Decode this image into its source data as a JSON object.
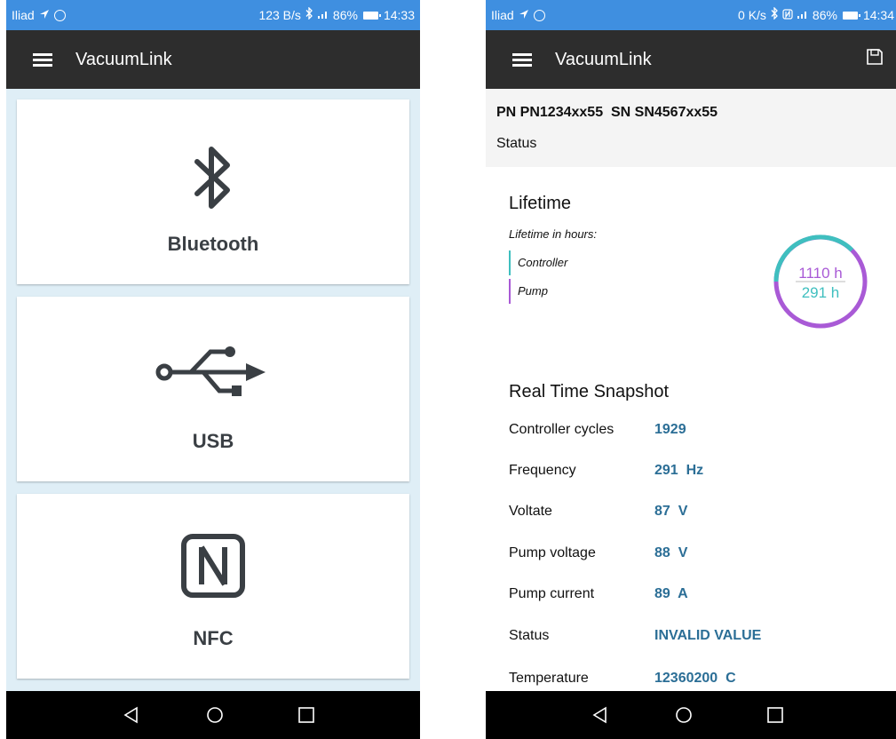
{
  "left": {
    "status_bar": {
      "carrier": "Iliad",
      "speed": "123 B/s",
      "battery": "86%",
      "time": "14:33"
    },
    "app_title": "VacuumLink",
    "connections": [
      {
        "label": "Bluetooth",
        "icon": "bluetooth-icon"
      },
      {
        "label": "USB",
        "icon": "usb-icon"
      },
      {
        "label": "NFC",
        "icon": "nfc-icon"
      }
    ]
  },
  "right": {
    "status_bar": {
      "carrier": "Iliad",
      "speed": "0 K/s",
      "battery": "86%",
      "time": "14:34"
    },
    "app_title": "VacuumLink",
    "pn_sn": "PN PN1234xx55  SN SN4567xx55",
    "status_link": "Status",
    "lifetime": {
      "title": "Lifetime",
      "subtitle": "Lifetime in hours:",
      "legend": [
        {
          "name": "Controller",
          "color": "#3fbfbf"
        },
        {
          "name": "Pump",
          "color": "#a95ad6"
        }
      ],
      "gauge": {
        "pump_value": "1110 h",
        "controller_value": "291 h",
        "pump_color": "#a95ad6",
        "controller_color": "#3fbfbf"
      }
    },
    "snapshot": {
      "title": "Real Time Snapshot",
      "rows": [
        {
          "label": "Controller cycles",
          "value": "1929"
        },
        {
          "label": "Frequency",
          "value": "291  Hz"
        },
        {
          "label": "Voltate",
          "value": "87  V"
        },
        {
          "label": "Pump voltage",
          "value": "88  V"
        },
        {
          "label": "Pump current",
          "value": "89  A"
        },
        {
          "label": "Status",
          "value": "INVALID VALUE"
        },
        {
          "label": "Temperature",
          "value": "12360200  C"
        }
      ]
    }
  },
  "colors": {
    "status_bar": "#3f8fe0",
    "app_bar": "#2d2d2d",
    "value_text": "#2b6e96",
    "list_background": "#dfeef6"
  }
}
